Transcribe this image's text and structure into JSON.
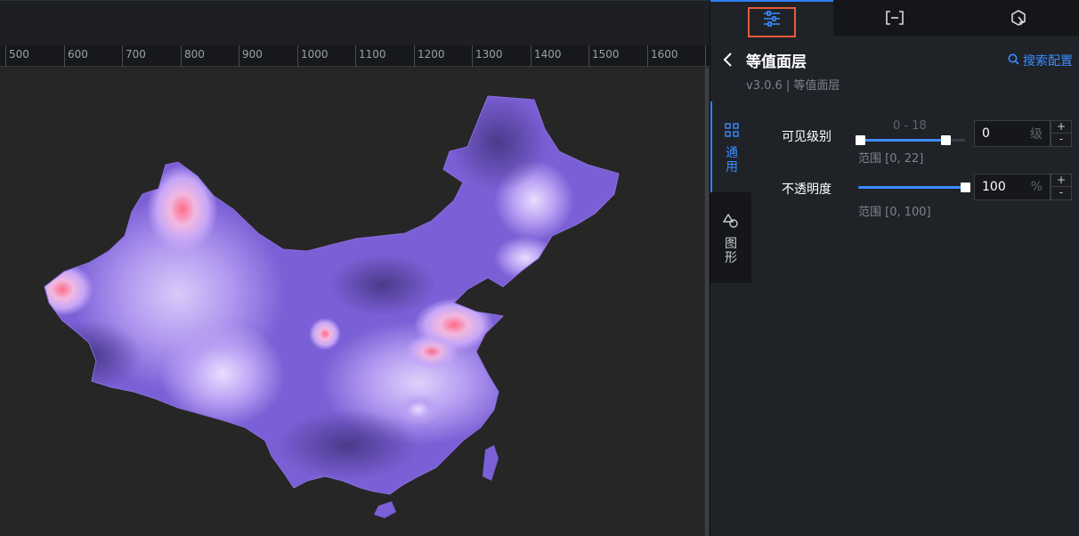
{
  "ruler": {
    "ticks": [
      "500",
      "600",
      "700",
      "800",
      "900",
      "1000",
      "1100",
      "1200",
      "1300",
      "1400",
      "1500",
      "1600"
    ]
  },
  "panel": {
    "tabs": [
      {
        "name": "config-tab",
        "icon": "sliders-icon",
        "active": true
      },
      {
        "name": "data-tab",
        "icon": "bracket-data-icon",
        "active": false
      },
      {
        "name": "interaction-tab",
        "icon": "interaction-icon",
        "active": false
      }
    ],
    "title": "等值面层",
    "version": "v3.0.6 | 等值面层",
    "search_label": "搜索配置",
    "side_tabs": [
      {
        "label": "通用",
        "icon": "grid-icon",
        "active": true
      },
      {
        "label": "图形",
        "icon": "shapes-icon",
        "active": false
      }
    ],
    "visible_level": {
      "label": "可见级别",
      "range_display": "0 - 18",
      "value": "0",
      "unit": "级",
      "hint": "范围 [0, 22]",
      "min": 0,
      "max": 22,
      "low": 0,
      "high": 18
    },
    "opacity": {
      "label": "不透明度",
      "value": "100",
      "unit": "%",
      "hint": "范围 [0, 100]",
      "min": 0,
      "max": 100,
      "current": 100
    },
    "stepper_plus": "+",
    "stepper_minus": "-"
  },
  "colors": {
    "accent": "#3b8cff",
    "highlight": "#e55b3a",
    "map_low": "#6a4fc8",
    "map_mid": "#b49bf5",
    "map_high": "#ff5a7a"
  }
}
